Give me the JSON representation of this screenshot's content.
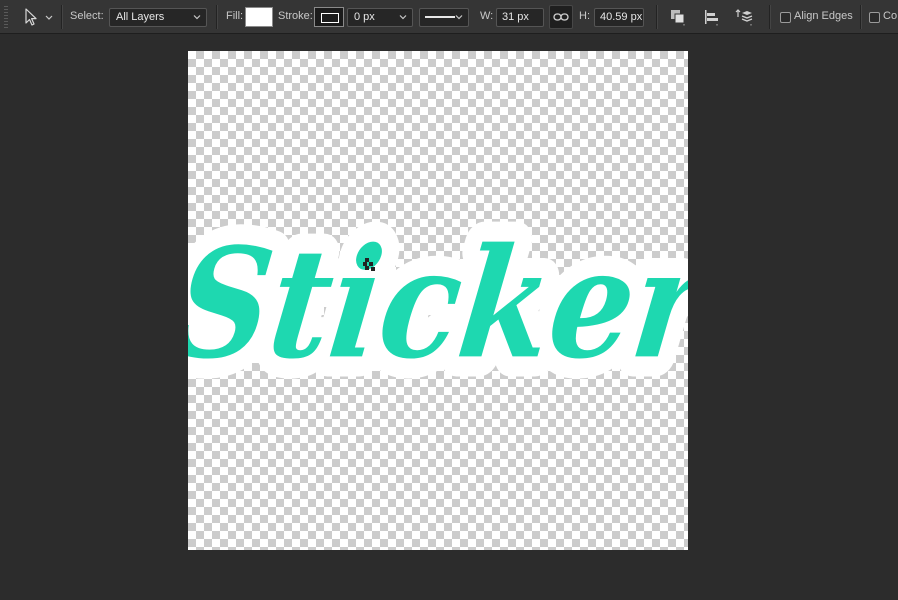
{
  "options_bar": {
    "select_label": "Select:",
    "select_value": "All Layers",
    "fill_label": "Fill:",
    "fill_color": "#ffffff",
    "stroke_label": "Stroke:",
    "stroke_width_value": "0 px",
    "width_label": "W:",
    "width_value": "31 px",
    "height_label": "H:",
    "height_value": "40.59 px",
    "align_edges_label": "Align Edges",
    "truncated_option_label": "Co"
  },
  "document": {
    "sticker_text": "Sticker",
    "text_color": "#1ed8b0",
    "outline_color": "#ffffff"
  }
}
